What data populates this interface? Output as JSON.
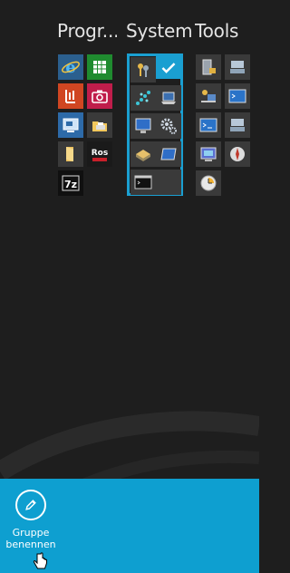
{
  "groups": [
    {
      "name": "Programme",
      "display": "Progr..."
    },
    {
      "name": "System",
      "display": "System"
    },
    {
      "name": "Tools",
      "display": "Tools"
    }
  ],
  "tiles": {
    "programs": [
      "internet-explorer",
      "spreadsheet",
      "document-reader",
      "camera",
      "remote-desktop",
      "folder-printer",
      "folder",
      "ros-app",
      "7zip"
    ],
    "ros_label": "Ros",
    "zip_label": "7z",
    "system": [
      "key-users",
      "check-selected",
      "network",
      "laptop",
      "monitor-settings",
      "gear-settings",
      "drive",
      "window",
      "command-prompt"
    ],
    "tools": [
      "server-lock",
      "computer-network",
      "user-computer",
      "terminal",
      "console",
      "printer-network",
      "event-viewer",
      "compass",
      "clock"
    ]
  },
  "appbar": {
    "rename_label": "Gruppe benennen",
    "rename_icon": "pencil-icon"
  },
  "colors": {
    "accent": "#1a9fd1",
    "appbar": "#0e9fd0",
    "background": "#1e1e1e"
  }
}
